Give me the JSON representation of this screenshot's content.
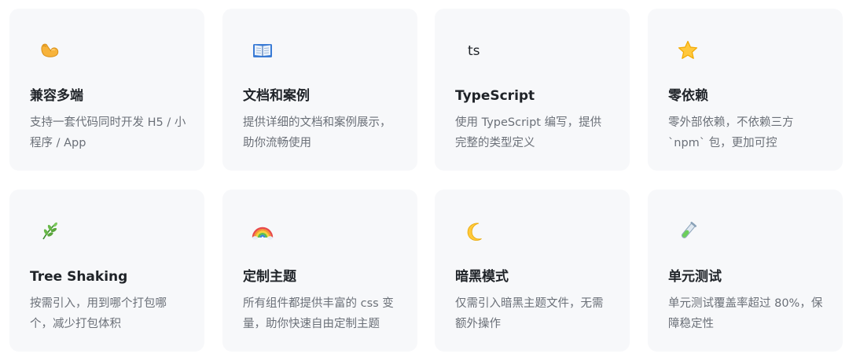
{
  "colors": {
    "card_background": "#f7f8fa",
    "title": "#1f2328",
    "description": "#6b7078"
  },
  "features": [
    {
      "icon": "flexed-biceps-icon",
      "title": "兼容多端",
      "desc": "支持一套代码同时开发 H5 / 小程序 / App"
    },
    {
      "icon": "open-book-icon",
      "title": "文档和案例",
      "desc": "提供详细的文档和案例展示，助你流畅使用"
    },
    {
      "icon": "typescript-logo-icon",
      "icon_text": "ts",
      "title": "TypeScript",
      "desc": "使用 TypeScript 编写，提供完整的类型定义"
    },
    {
      "icon": "star-icon",
      "title": "零依赖",
      "desc": "零外部依赖，不依赖三方 `npm` 包，更加可控"
    },
    {
      "icon": "herb-icon",
      "title": "Tree Shaking",
      "desc": "按需引入，用到哪个打包哪个，减少打包体积"
    },
    {
      "icon": "rainbow-icon",
      "title": "定制主题",
      "desc": "所有组件都提供丰富的 css 变量，助你快速自由定制主题"
    },
    {
      "icon": "crescent-moon-icon",
      "title": "暗黑模式",
      "desc": "仅需引入暗黑主题文件，无需额外操作"
    },
    {
      "icon": "test-tube-icon",
      "title": "单元测试",
      "desc": "单元测试覆盖率超过 80%，保障稳定性"
    }
  ]
}
